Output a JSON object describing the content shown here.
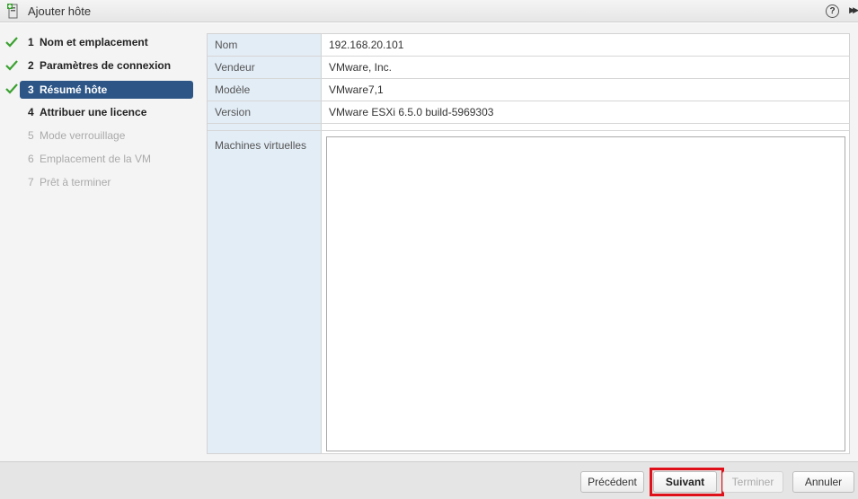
{
  "dialog": {
    "title": "Ajouter hôte",
    "help_glyph": "?",
    "expand_glyph": "▶▶"
  },
  "steps": [
    {
      "num": "1",
      "label": "Nom et emplacement",
      "state": "done"
    },
    {
      "num": "2",
      "label": "Paramètres de connexion",
      "state": "done"
    },
    {
      "num": "3",
      "label": "Résumé hôte",
      "state": "current"
    },
    {
      "num": "4",
      "label": "Attribuer une licence",
      "state": "todo"
    },
    {
      "num": "5",
      "label": "Mode verrouillage",
      "state": "disabled"
    },
    {
      "num": "6",
      "label": "Emplacement de la VM",
      "state": "disabled"
    },
    {
      "num": "7",
      "label": "Prêt à terminer",
      "state": "disabled"
    }
  ],
  "summary": {
    "rows": [
      {
        "label": "Nom",
        "value": "192.168.20.101"
      },
      {
        "label": "Vendeur",
        "value": "VMware, Inc."
      },
      {
        "label": "Modèle",
        "value": "VMware7,1"
      },
      {
        "label": "Version",
        "value": "VMware ESXi 6.5.0 build-5969303"
      }
    ],
    "vm_label": "Machines virtuelles"
  },
  "footer": {
    "back_label": "Précédent",
    "next_label": "Suivant",
    "finish_label": "Terminer",
    "cancel_label": "Annuler"
  },
  "colors": {
    "current_step_bg": "#2d5687",
    "check_green": "#3aa130",
    "highlight_red": "#e0101a"
  }
}
